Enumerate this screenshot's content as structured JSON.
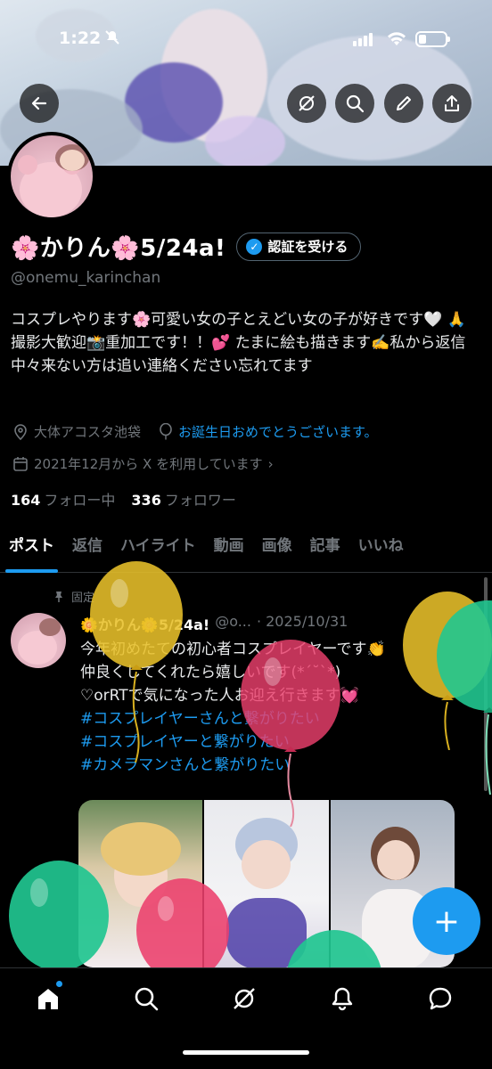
{
  "status_bar": {
    "time": "1:22"
  },
  "profile": {
    "name": "🌸かりん🌸5/24a!",
    "verify_label": "認証を受ける",
    "handle": "@onemu_karinchan",
    "bio": "コスプレやります🌸可愛い女の子とえどい女の子が好きです🤍 🙏 撮影大歓迎📸重加工です！！💕 たまに絵も描きます✍️私から返信中々来ない方は追い連絡ください忘れてます",
    "location": "大体アコスタ池袋",
    "birthday": "お誕生日おめでとうございます。",
    "joined": "2021年12月から X を利用しています",
    "following_count": "164",
    "following_label": "フォロー中",
    "followers_count": "336",
    "followers_label": "フォロワー"
  },
  "tabs": [
    "ポスト",
    "返信",
    "ハイライト",
    "動画",
    "画像",
    "記事",
    "いいね"
  ],
  "pinned_post": {
    "pinned_label": "固定",
    "name": "🌼かりん🌼5/24a!",
    "handle": "@o...",
    "date": "· 2025/10/31",
    "lines": [
      "今年初めたての初心者コスプレイヤーです👏",
      "仲良くしてくれたら嬉しいです(*´˘`*)",
      "♡orRTで気になった人お迎え行きます💓"
    ],
    "hashtags": [
      "#コスプレイヤーさんと繋がりたい",
      "#コスプレイヤーと繋がりたい",
      "#カメラマンさんと繋がりたい"
    ]
  },
  "fab_label": "+",
  "colors": {
    "accent": "#1d9bf0",
    "background": "#000000",
    "muted": "#71767b"
  },
  "icons": [
    "back-arrow-icon",
    "grok-icon",
    "search-icon",
    "edit-pencil-icon",
    "share-icon",
    "location-pin-icon",
    "balloon-icon",
    "calendar-icon",
    "home-icon",
    "notifications-icon",
    "messages-icon"
  ]
}
